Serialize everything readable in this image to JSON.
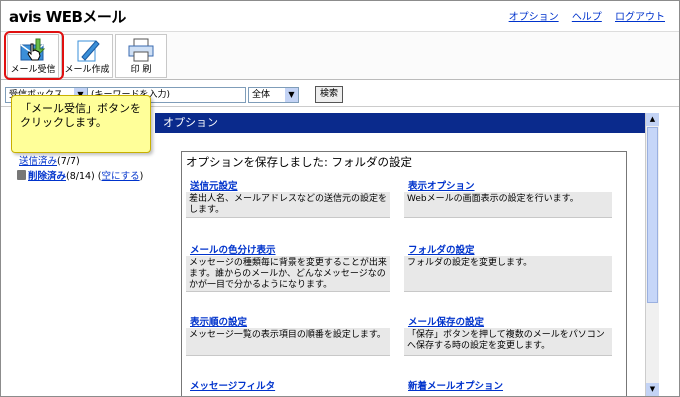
{
  "header": {
    "logo": "avis WEBメール",
    "links": [
      "オプション",
      "ヘルプ",
      "ログアウト"
    ]
  },
  "toolbar": {
    "receive": "メール受信",
    "compose": "メール作成",
    "print": "印 刷"
  },
  "search": {
    "folder": "受信ボックス",
    "keyword": "(キーワードを入力)",
    "scope": "全体",
    "button": "検索"
  },
  "tree": {
    "sent_label": "送信済み",
    "sent_count": "(7/7)",
    "trash_label": "削除済み",
    "trash_count": "(8/14)",
    "empty": "空にする"
  },
  "main": {
    "title": "オプション",
    "panel_title": "オプションを保存しました: フォルダの設定"
  },
  "items": [
    {
      "title": "送信元設定",
      "desc": "差出人名、メールアドレスなどの送信元の設定をします。"
    },
    {
      "title": "表示オプション",
      "desc": "Webメールの画面表示の設定を行います。"
    },
    {
      "title": "メールの色分け表示",
      "desc": "メッセージの種類毎に背景を変更することが出来ます。誰からのメールか、どんなメッセージなのかが一目で分かるようになります。"
    },
    {
      "title": "フォルダの設定",
      "desc": "フォルダの設定を変更します。"
    },
    {
      "title": "表示順の設定",
      "desc": "メッセージ一覧の表示項目の順番を設定します。"
    },
    {
      "title": "メール保存の設定",
      "desc": "「保存」ボタンを押して複数のメールをパソコンへ保存する時の設定を変更します。"
    },
    {
      "title": "メッセージフィルタ",
      "desc": ""
    },
    {
      "title": "新着メールオプション",
      "desc": ""
    }
  ],
  "callout": "「メール受信」ボタンをクリックします。",
  "colors": {
    "title_bar": "#0a2a8c",
    "highlight": "#e01010",
    "callout": "#ffff99"
  }
}
